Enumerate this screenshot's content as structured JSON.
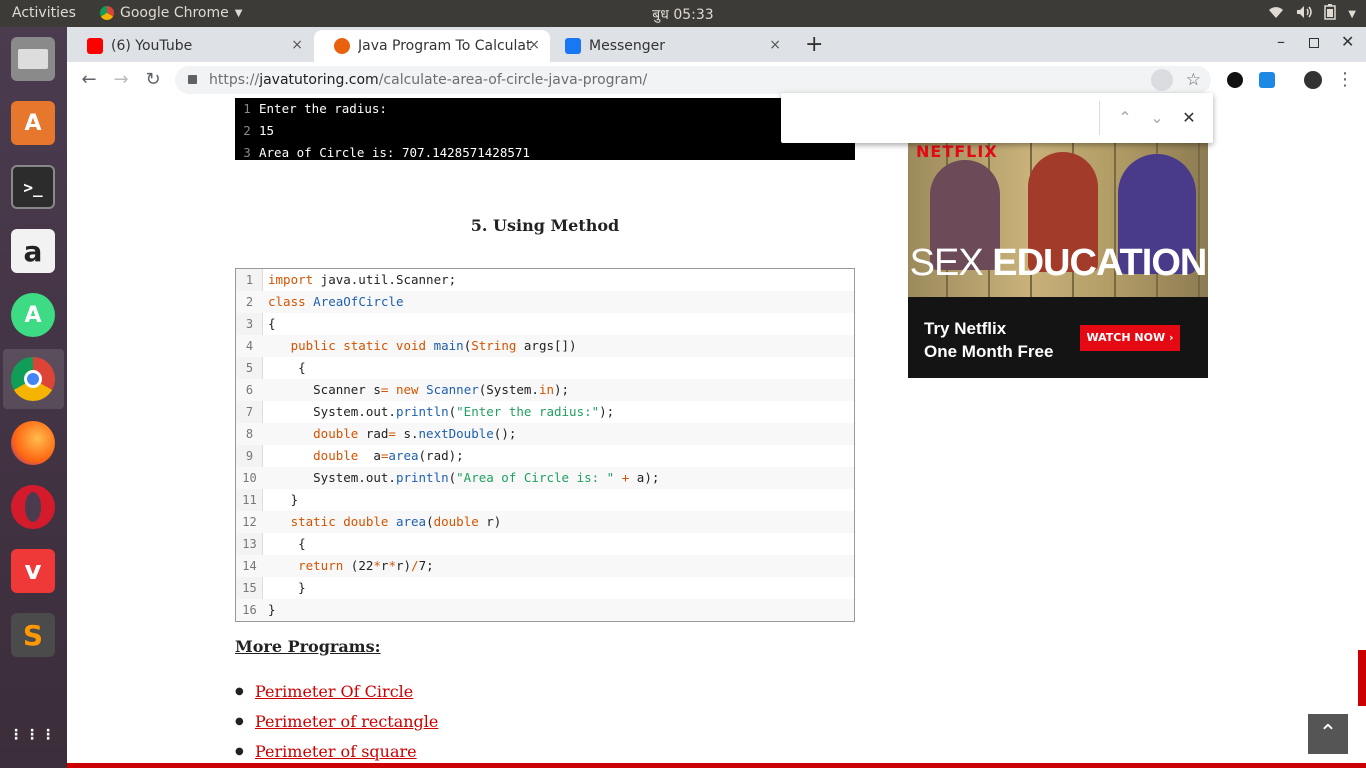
{
  "system": {
    "activities": "Activities",
    "app_name": "Google Chrome",
    "clock": "बुध 05:33"
  },
  "tabs": [
    {
      "label": "(6) YouTube",
      "close": "×"
    },
    {
      "label": "Java Program To Calculate",
      "close": "×"
    },
    {
      "label": "Messenger",
      "close": "×"
    }
  ],
  "new_tab": "+",
  "address": {
    "scheme": "https://",
    "host": "javatutoring.com",
    "path": "/calculate-area-of-circle-java-program/"
  },
  "output": {
    "lines": [
      "Enter the radius:",
      "15",
      "Area of Circle is: 707.1428571428571"
    ]
  },
  "section_heading": "5. Using Method",
  "code": {
    "numbers": [
      "1",
      "2",
      "3",
      "4",
      "5",
      "6",
      "7",
      "8",
      "9",
      "10",
      "11",
      "12",
      "13",
      "14",
      "15",
      "16"
    ]
  },
  "more_programs": "More Programs:",
  "links": [
    "Perimeter Of Circle",
    "Perimeter of rectangle",
    "Perimeter of square"
  ],
  "ad": {
    "brand": "NETFLIX",
    "title_light": "SEX",
    "title_bold": "EDUCATION",
    "line1": "Try Netflix",
    "line2": "One Month Free",
    "cta": "WATCH NOW"
  },
  "icons": [
    "wifi-icon",
    "volume-icon",
    "battery-icon",
    "power-menu-icon",
    "back-icon",
    "forward-icon",
    "reload-icon",
    "lock-icon",
    "zoom-icon",
    "bookmark-star-icon",
    "extension-icon",
    "avatar",
    "menu-icon",
    "chevron-up-icon",
    "chevron-down-icon",
    "close-icon",
    "scroll-top-icon"
  ],
  "colors": {
    "accent": "#cc0000",
    "keyword": "#d35400",
    "class": "#2060b0",
    "string": "#20a060"
  }
}
